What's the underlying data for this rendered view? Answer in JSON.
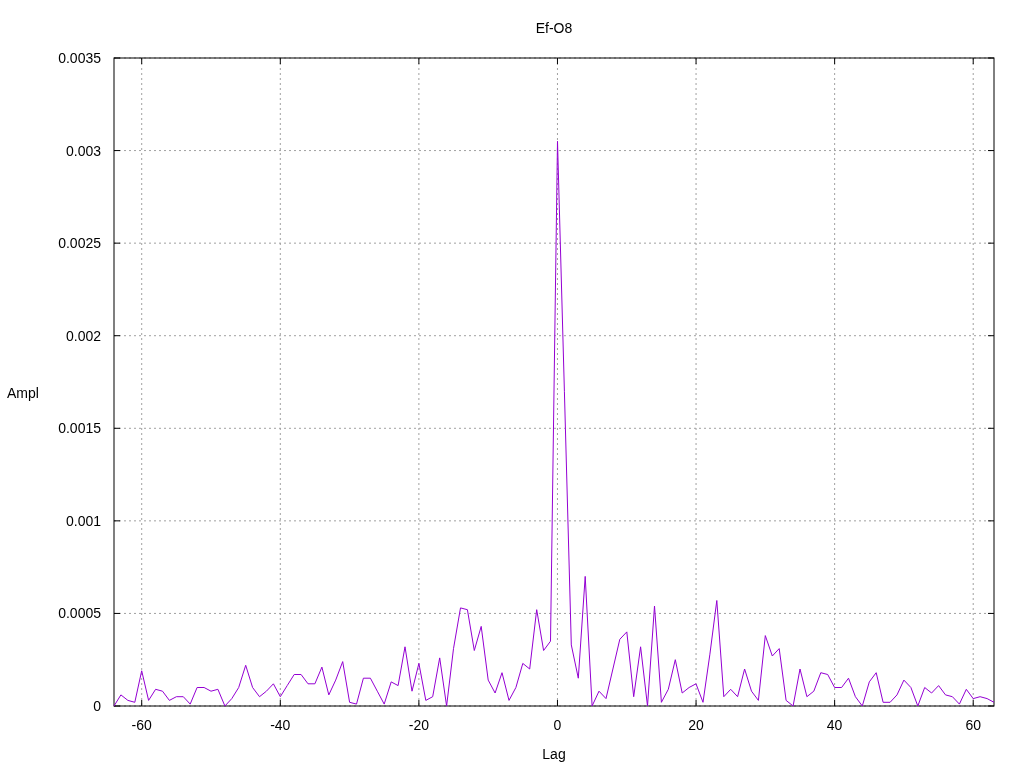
{
  "chart_data": {
    "type": "line",
    "title": "Ef-O8",
    "xlabel": "Lag",
    "ylabel": "Ampl",
    "grid": true,
    "xlim": [
      -64,
      63
    ],
    "ylim": [
      0,
      0.0035
    ],
    "xticks": [
      -60,
      -40,
      -20,
      0,
      20,
      40,
      60
    ],
    "yticks": [
      0,
      0.0005,
      0.001,
      0.0015,
      0.002,
      0.0025,
      0.003,
      0.0035
    ],
    "x": [
      -64,
      -63,
      -62,
      -61,
      -60,
      -59,
      -58,
      -57,
      -56,
      -55,
      -54,
      -53,
      -52,
      -51,
      -50,
      -49,
      -48,
      -47,
      -46,
      -45,
      -44,
      -43,
      -42,
      -41,
      -40,
      -39,
      -38,
      -37,
      -36,
      -35,
      -34,
      -33,
      -32,
      -31,
      -30,
      -29,
      -28,
      -27,
      -26,
      -25,
      -24,
      -23,
      -22,
      -21,
      -20,
      -19,
      -18,
      -17,
      -16,
      -15,
      -14,
      -13,
      -12,
      -11,
      -10,
      -9,
      -8,
      -7,
      -6,
      -5,
      -4,
      -3,
      -2,
      -1,
      0,
      1,
      2,
      3,
      4,
      5,
      6,
      7,
      8,
      9,
      10,
      11,
      12,
      13,
      14,
      15,
      16,
      17,
      18,
      19,
      20,
      21,
      22,
      23,
      24,
      25,
      26,
      27,
      28,
      29,
      30,
      31,
      32,
      33,
      34,
      35,
      36,
      37,
      38,
      39,
      40,
      41,
      42,
      43,
      44,
      45,
      46,
      47,
      48,
      49,
      50,
      51,
      52,
      53,
      54,
      55,
      56,
      57,
      58,
      59,
      60,
      61,
      62,
      63
    ],
    "series": [
      {
        "color": "#9400d3",
        "values": [
          0,
          6e-05,
          3e-05,
          2e-05,
          0.00019,
          3e-05,
          9e-05,
          8e-05,
          3e-05,
          5e-05,
          5e-05,
          1e-05,
          0.0001,
          0.0001,
          8e-05,
          9e-05,
          0,
          4e-05,
          0.0001,
          0.00022,
          0.0001,
          5e-05,
          8e-05,
          0.00012,
          5e-05,
          0.00011,
          0.00017,
          0.00017,
          0.00012,
          0.00012,
          0.00021,
          6e-05,
          0.00014,
          0.00024,
          2e-05,
          1e-05,
          0.00015,
          0.00015,
          8e-05,
          1e-05,
          0.00013,
          0.00011,
          0.00032,
          8e-05,
          0.00023,
          3e-05,
          5e-05,
          0.00026,
          0,
          0.00031,
          0.00053,
          0.00052,
          0.0003,
          0.00043,
          0.00014,
          7e-05,
          0.00018,
          3e-05,
          0.0001,
          0.00023,
          0.0002,
          0.00052,
          0.0003,
          0.00035,
          0.00305,
          0.0017,
          0.00033,
          0.00015,
          0.0007,
          0,
          8e-05,
          4e-05,
          0.0002,
          0.00036,
          0.0004,
          5e-05,
          0.00032,
          0,
          0.00054,
          2e-05,
          9e-05,
          0.00025,
          7e-05,
          0.0001,
          0.00012,
          2e-05,
          0.00028,
          0.00057,
          5e-05,
          9e-05,
          5e-05,
          0.0002,
          8e-05,
          3e-05,
          0.00038,
          0.00027,
          0.00031,
          3e-05,
          0,
          0.0002,
          5e-05,
          8e-05,
          0.00018,
          0.00017,
          0.0001,
          0.0001,
          0.00015,
          5e-05,
          0,
          0.00013,
          0.00018,
          2e-05,
          2e-05,
          6e-05,
          0.00014,
          0.0001,
          0,
          0.0001,
          7e-05,
          0.00011,
          6e-05,
          5e-05,
          1e-05,
          9e-05,
          4e-05,
          5e-05,
          4e-05,
          2e-05
        ]
      }
    ]
  }
}
